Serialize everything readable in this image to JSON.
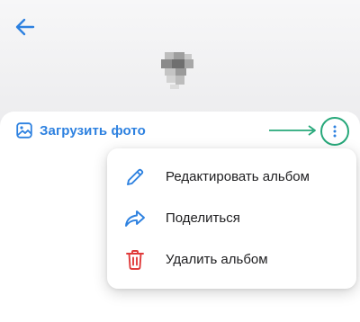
{
  "header": {
    "back_icon": "arrow-left-icon",
    "avatar_icon": "blurred-avatar"
  },
  "toolbar": {
    "upload_label": "Загрузить фото",
    "upload_icon": "image-icon",
    "more_icon": "vertical-dots-icon"
  },
  "annotation": {
    "arrow_color": "#27a87a",
    "highlight_color": "#27a87a"
  },
  "menu": {
    "items": [
      {
        "label": "Редактировать альбом",
        "icon": "pencil-icon",
        "color": "#2d81e0"
      },
      {
        "label": "Поделиться",
        "icon": "share-icon",
        "color": "#2d81e0"
      },
      {
        "label": "Удалить альбом",
        "icon": "trash-icon",
        "color": "#e03b3b"
      }
    ]
  },
  "colors": {
    "accent": "#2d81e0",
    "danger": "#e03b3b",
    "text": "#1d1d1f",
    "background": "#e9eaec"
  }
}
